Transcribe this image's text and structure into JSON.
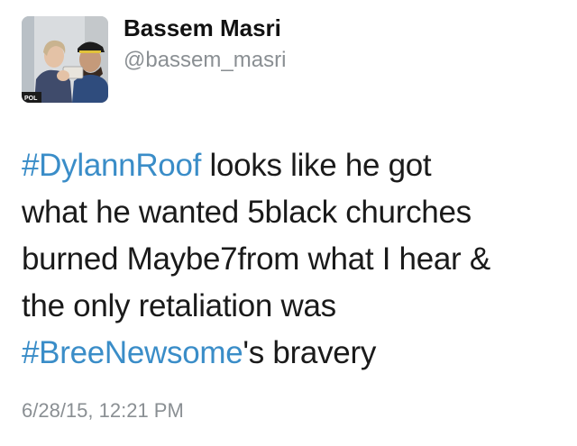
{
  "tweet": {
    "author": {
      "name": "Bassem Masri",
      "handle": "@bassem_masri",
      "avatar_badge_text": "POL"
    },
    "body": {
      "line1_hashtag": "#DylannRoof",
      "line1_rest": " looks like he got",
      "line2": "what he wanted 5black churches",
      "line3": "burned Maybe7from what I hear &",
      "line4": "the only retaliation was",
      "line5_hashtag": "#BreeNewsome",
      "line5_rest": "'s bravery"
    },
    "timestamp": "6/28/15, 12:21 PM"
  },
  "colors": {
    "hashtag": "#3a8dc8",
    "text": "#1a1a1a",
    "meta": "#8a8f93",
    "background": "#ffffff"
  }
}
